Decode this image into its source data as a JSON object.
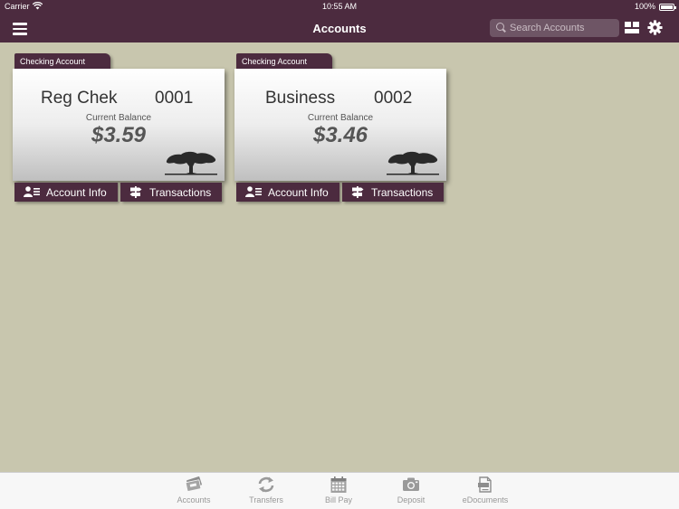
{
  "status_bar": {
    "carrier": "Carrier",
    "time": "10:55 AM",
    "battery": "100%"
  },
  "nav": {
    "title": "Accounts",
    "search_placeholder": "Search Accounts"
  },
  "accounts": [
    {
      "type": "Checking Account",
      "name": "Reg Chek",
      "number": "0001",
      "balance_label": "Current Balance",
      "balance": "$3.59"
    },
    {
      "type": "Checking Account",
      "name": "Business",
      "number": "0002",
      "balance_label": "Current Balance",
      "balance": "$3.46"
    }
  ],
  "card_buttons": {
    "info": "Account Info",
    "transactions": "Transactions"
  },
  "tab_bar": {
    "items": [
      {
        "label": "Accounts",
        "icon": "accounts-icon"
      },
      {
        "label": "Transfers",
        "icon": "transfers-icon"
      },
      {
        "label": "Bill Pay",
        "icon": "calendar-icon"
      },
      {
        "label": "Deposit",
        "icon": "camera-icon"
      },
      {
        "label": "eDocuments",
        "icon": "document-icon"
      }
    ]
  },
  "colors": {
    "brand": "#4c2b3f",
    "background": "#c8c6ae"
  }
}
